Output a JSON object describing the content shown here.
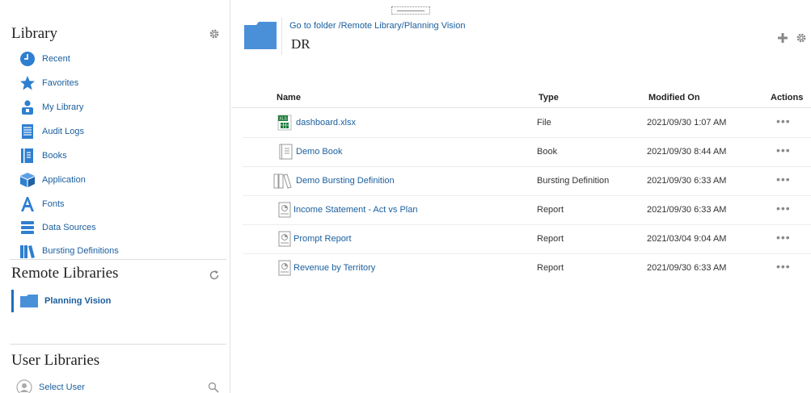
{
  "sidebar": {
    "library_title": "Library",
    "items": [
      {
        "label": "Recent",
        "icon": "clock-icon"
      },
      {
        "label": "Favorites",
        "icon": "star-icon"
      },
      {
        "label": "My Library",
        "icon": "person-icon"
      },
      {
        "label": "Audit Logs",
        "icon": "log-icon"
      },
      {
        "label": "Books",
        "icon": "book-icon"
      },
      {
        "label": "Application",
        "icon": "cube-icon"
      },
      {
        "label": "Fonts",
        "icon": "font-icon"
      },
      {
        "label": "Data Sources",
        "icon": "database-icon"
      },
      {
        "label": "Bursting Definitions",
        "icon": "bursting-icon"
      }
    ],
    "remote_title": "Remote Libraries",
    "remote_items": [
      {
        "label": "Planning Vision",
        "icon": "folder-icon"
      }
    ],
    "user_title": "User Libraries",
    "select_user_label": "Select User"
  },
  "main": {
    "breadcrumb": "Go to folder /Remote Library/Planning Vision",
    "title": "DR",
    "columns": {
      "name": "Name",
      "type": "Type",
      "modified": "Modified On",
      "actions": "Actions"
    },
    "rows": [
      {
        "name": "dashboard.xlsx",
        "type": "File",
        "modified": "2021/09/30 1:07 AM",
        "icon": "excel-file-icon"
      },
      {
        "name": "Demo Book",
        "type": "Book",
        "modified": "2021/09/30 8:44 AM",
        "icon": "book-doc-icon"
      },
      {
        "name": "Demo Bursting Definition",
        "type": "Bursting Definition",
        "modified": "2021/09/30 6:33 AM",
        "icon": "bursting-def-icon"
      },
      {
        "name": "Income Statement - Act vs Plan",
        "type": "Report",
        "modified": "2021/09/30 6:33 AM",
        "icon": "report-icon"
      },
      {
        "name": "Prompt Report",
        "type": "Report",
        "modified": "2021/03/04 9:04 AM",
        "icon": "report-icon"
      },
      {
        "name": "Revenue by Territory",
        "type": "Report",
        "modified": "2021/09/30 6:33 AM",
        "icon": "report-icon"
      }
    ],
    "actions_glyph": "•••"
  },
  "colors": {
    "accent": "#1f6fbf",
    "link": "#1a5e9e",
    "icon_blue": "#4a90d9"
  }
}
